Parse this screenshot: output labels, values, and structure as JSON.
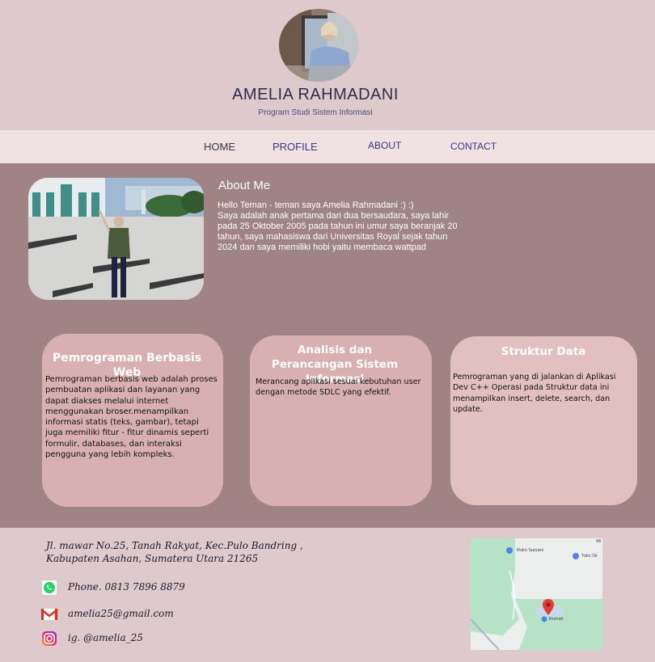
{
  "header": {
    "name": "AMELIA RAHMADANI",
    "subtitle": "Program Studi Sistem Informasi"
  },
  "nav": {
    "home": "HOME",
    "profile": "PROFILE",
    "about": "ABOUT",
    "contact": "CONTACT"
  },
  "about": {
    "title": "About Me",
    "text": "Hello Teman - teman saya Amelia Rahmadani :) :)\nSaya adalah anak pertama dari dua bersaudara, saya lahir pada 25 Oktober 2005 pada tahun ini umur saya beranjak 20 tahun, saya mahasiswa dari Universitas Royal sejak tahun 2024 dan saya memiliki hobi yaitu membaca wattpad"
  },
  "cards": [
    {
      "title": "Pemrograman Berbasis Web",
      "text": "Pemrograman berbasis web adalah proses pembuatan aplikasi dan layanan yang dapat diakses melalui internet menggunakan broser.menampilkan informasi statis (teks, gambar),  tetapi juga memiliki fitur - fitur dinamis seperti formulir, databases, dan interaksi pengguna yang lebih kompleks."
    },
    {
      "title": "Analisis dan Perancangan Sistem Informasi",
      "text": "Merancang aplikasi sesuai kebutuhan user\n dengan metode SDLC yang efektif."
    },
    {
      "title": "Struktur Data",
      "text": "Pemrograman yang di jalankan di Aplikasi\nDev C++ Operasi pada Struktur data ini\n menampilkan insert, delete, search, dan update."
    }
  ],
  "footer": {
    "address": "Jl. mawar No.25, Tanah Rakyat, Kec.Pulo Bandring ,\nKabupaten Asahan, Sumatera Utara  21265",
    "phone": "Phone. 0813 7896 8879",
    "email": "amelia25@gmail.com",
    "instagram": "ig. @amelia_25",
    "map": {
      "label_ruko": "Ruko Suryani",
      "label_toko": "Toko Sir",
      "label_rumah": "Rumah",
      "label_w": "Wi"
    }
  },
  "colors": {
    "header_bg": "#decacd",
    "nav_bg": "#f0e1e3",
    "main_bg": "#a08385",
    "card_bg": "#d8b0b1",
    "card3_bg": "#e3c0c0"
  },
  "icons": {
    "phone": "whatsapp-icon",
    "email": "gmail-icon",
    "instagram": "instagram-icon",
    "map_pin": "map-pin-icon"
  }
}
